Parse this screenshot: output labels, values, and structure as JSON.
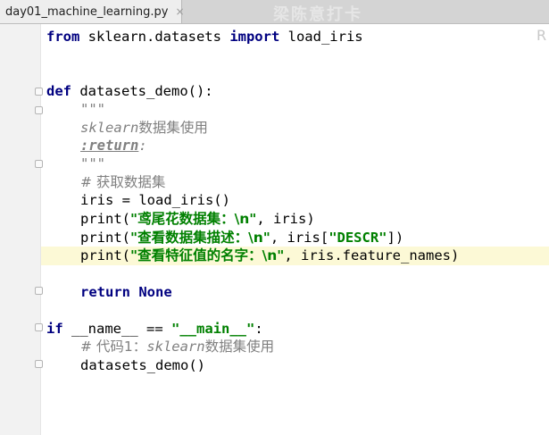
{
  "tab": {
    "label": "day01_machine_learning.py",
    "close": "×"
  },
  "watermark": "梁陈意打卡",
  "corner_mark": "R",
  "code": {
    "l1": {
      "kw": "from",
      "a": " sklearn.datasets ",
      "kw2": "import",
      "b": " load_iris"
    },
    "l4": {
      "kw": "def",
      "name": " datasets_demo():"
    },
    "l5": {
      "doc": "\"\"\""
    },
    "l6": {
      "doc": "sklearn",
      "cn": "数据集使用"
    },
    "l7": {
      "doc": ":return",
      "colon": ":"
    },
    "l8": {
      "doc": "\"\"\""
    },
    "l9": {
      "cmt": "# 获取数据集"
    },
    "l10": {
      "text": "iris = load_iris()"
    },
    "l11": {
      "p": "print(",
      "s": "\"鸢尾花数据集：\\n\"",
      "r": ", iris)"
    },
    "l12": {
      "p": "print(",
      "s": "\"查看数据集描述：\\n\"",
      "m": ", iris[",
      "s2": "\"DESCR\"",
      "r": "])"
    },
    "l13": {
      "p": "print(",
      "s": "\"查看特征值的名字：\\n\"",
      "r": ", iris.feature_names)"
    },
    "l15": {
      "kw": "return",
      "kw2": " None"
    },
    "l17": {
      "kw": "if",
      "a": " __name__ == ",
      "s": "\"__main__\"",
      "b": ":"
    },
    "l18": {
      "cmt": "# 代码1：",
      "doc": "sklearn",
      "cmt2": "数据集使用"
    },
    "l19": {
      "text": "datasets_demo()"
    }
  }
}
